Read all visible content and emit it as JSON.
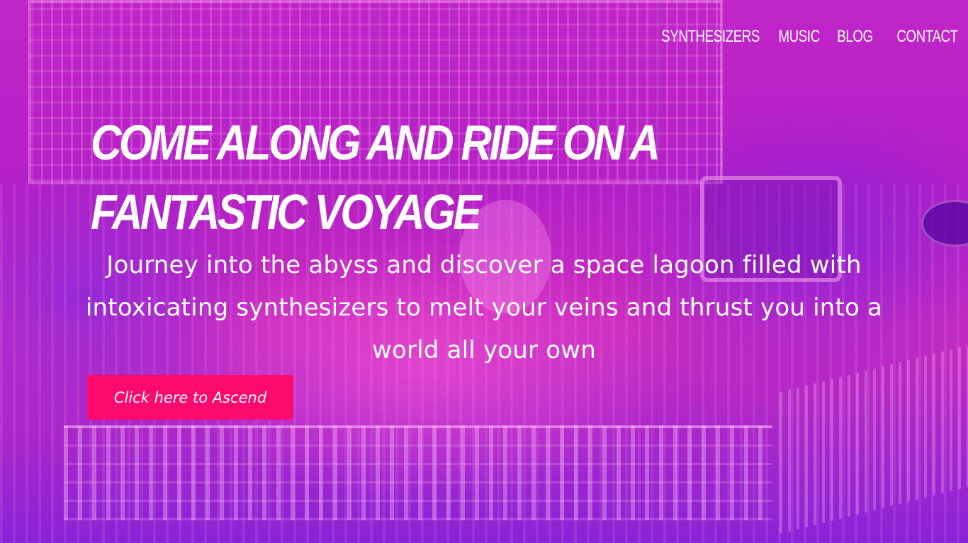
{
  "nav": {
    "items": [
      {
        "label": "SYNTHESIZERS"
      },
      {
        "label": "MUSIC"
      },
      {
        "label": "BLOG"
      },
      {
        "label": "CONTACT"
      }
    ]
  },
  "hero": {
    "title": "COME ALONG AND RIDE ON A FANTASTIC VOYAGE",
    "text": "Journey into the abyss and discover a space lagoon filled with intoxicating synthesizers to melt your veins and thrust you into a world all your own",
    "button_label": "Click here to Ascend",
    "background_image": "synthesizer-studio-photo",
    "colors": {
      "overlay_pink": "#c025c8",
      "overlay_purple": "#4a10c8",
      "button": "#fe0a6e",
      "text": "#ffffff"
    }
  }
}
